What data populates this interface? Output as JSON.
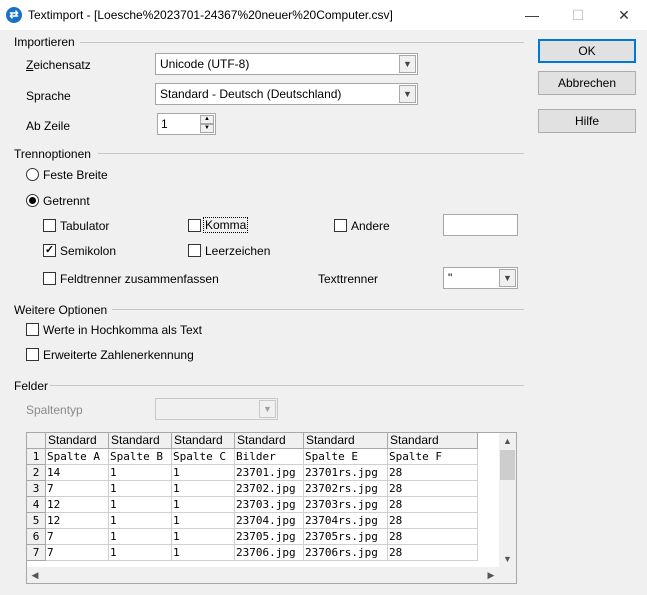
{
  "window": {
    "title": "Textimport - [Loesche%2023701-24367%20neuer%20Computer.csv]",
    "minimize": "—",
    "maximize": "☐",
    "close": "✕"
  },
  "import": {
    "section": "Importieren",
    "charset_label": "Zeichensatz",
    "charset_value": "Unicode (UTF-8)",
    "language_label": "Sprache",
    "language_value": "Standard - Deutsch (Deutschland)",
    "from_row_label": "Ab Zeile",
    "from_row_value": "1"
  },
  "separator": {
    "section": "Trennoptionen",
    "fixed_width": "Feste Breite",
    "separated": "Getrennt",
    "tab": "Tabulator",
    "comma": "Komma",
    "other": "Andere",
    "semicolon": "Semikolon",
    "space": "Leerzeichen",
    "merge": "Feldtrenner zusammenfassen",
    "text_delimiter_label": "Texttrenner",
    "text_delimiter_value": "\"",
    "other_value": ""
  },
  "further": {
    "section": "Weitere Optionen",
    "quoted_as_text": "Werte in Hochkomma als Text",
    "detect_numbers": "Erweiterte Zahlenerkennung"
  },
  "fields": {
    "section": "Felder",
    "column_type_label": "Spaltentyp",
    "column_type_value": ""
  },
  "buttons": {
    "ok": "OK",
    "cancel": "Abbrechen",
    "help": "Hilfe"
  },
  "preview": {
    "headers": [
      "Standard",
      "Standard",
      "Standard",
      "Standard",
      "Standard",
      "Standard"
    ],
    "row_numbers": [
      "1",
      "2",
      "3",
      "4",
      "5",
      "6",
      "7"
    ],
    "rows": [
      [
        "Spalte A",
        "Spalte B",
        "Spalte C",
        "Bilder",
        "Spalte E",
        "Spalte F"
      ],
      [
        "14",
        "1",
        "1",
        "23701.jpg",
        "23701rs.jpg",
        "28"
      ],
      [
        "7",
        "1",
        "1",
        "23702.jpg",
        "23702rs.jpg",
        "28"
      ],
      [
        "12",
        "1",
        "1",
        "23703.jpg",
        "23703rs.jpg",
        "28"
      ],
      [
        "12",
        "1",
        "1",
        "23704.jpg",
        "23704rs.jpg",
        "28"
      ],
      [
        "7",
        "1",
        "1",
        "23705.jpg",
        "23705rs.jpg",
        "28"
      ],
      [
        "7",
        "1",
        "1",
        "23706.jpg",
        "23706rs.jpg",
        "28"
      ]
    ]
  }
}
